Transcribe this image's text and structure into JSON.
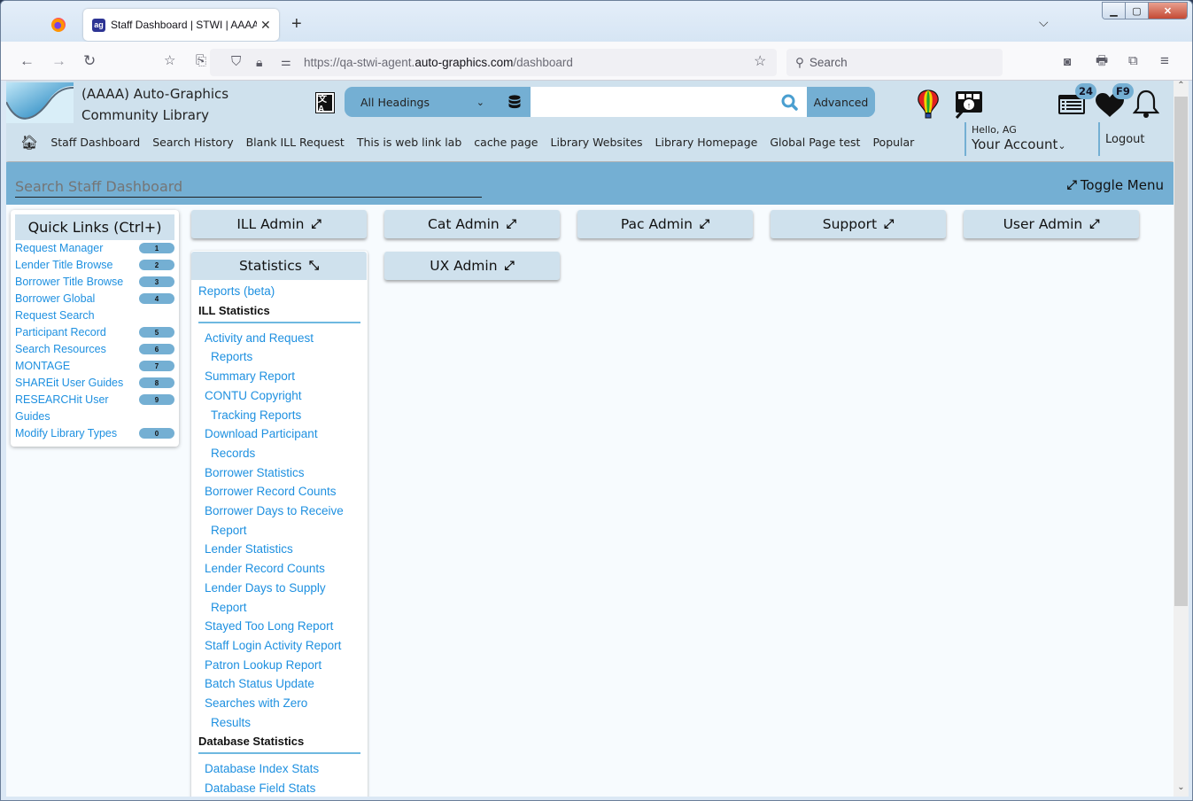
{
  "browser": {
    "tab_title": "Staff Dashboard | STWI | AAAA",
    "tab_favicon": "ag",
    "url_prefix": "https://qa-stwi-agent.",
    "url_domain": "auto-graphics.com",
    "url_path": "/dashboard",
    "search_placeholder": "Search"
  },
  "header": {
    "library_name_line1": "(AAAA) Auto-Graphics",
    "library_name_line2": "Community Library",
    "search_scope": "All Headings",
    "search_value": "",
    "advanced_label": "Advanced",
    "badges": {
      "list": "24",
      "favorites": "F9"
    },
    "nav": [
      "Staff Dashboard",
      "Search History",
      "Blank ILL Request",
      "This is web link lab",
      "cache page",
      "Library Websites",
      "Library Homepage",
      "Global Page test",
      "Popular"
    ],
    "hello": "Hello, AG",
    "account": "Your Account",
    "logout": "Logout"
  },
  "dashboard": {
    "search_placeholder": "Search Staff Dashboard",
    "toggle_menu": "Toggle Menu"
  },
  "quick_links": {
    "title": "Quick Links (Ctrl+)",
    "items": [
      {
        "label": "Request Manager",
        "key": "1"
      },
      {
        "label": "Lender Title Browse",
        "key": "2"
      },
      {
        "label": "Borrower Title Browse",
        "key": "3"
      },
      {
        "label": "Borrower Global Request Search",
        "key": "4"
      },
      {
        "label": "Participant Record",
        "key": "5"
      },
      {
        "label": "Search Resources",
        "key": "6"
      },
      {
        "label": "MONTAGE",
        "key": "7"
      },
      {
        "label": "SHAREit User Guides",
        "key": "8"
      },
      {
        "label": "RESEARCHit User Guides",
        "key": "9"
      },
      {
        "label": "Modify Library Types",
        "key": "0"
      }
    ]
  },
  "admin_cards": [
    {
      "label": "ILL Admin",
      "state": "collapsed"
    },
    {
      "label": "Cat Admin",
      "state": "collapsed"
    },
    {
      "label": "Pac Admin",
      "state": "collapsed"
    },
    {
      "label": "Support",
      "state": "collapsed"
    },
    {
      "label": "User Admin",
      "state": "collapsed"
    },
    {
      "label": "Statistics",
      "state": "expanded"
    },
    {
      "label": "UX Admin",
      "state": "collapsed"
    }
  ],
  "statistics": {
    "top_link": "Reports (beta)",
    "ill_heading": "ILL Statistics",
    "ill_links": [
      [
        "Activity and Request",
        "Reports"
      ],
      [
        "Summary Report"
      ],
      [
        "CONTU Copyright",
        "Tracking Reports"
      ],
      [
        "Download Participant",
        "Records"
      ],
      [
        "Borrower Statistics"
      ],
      [
        "Borrower Record Counts"
      ],
      [
        "Borrower Days to Receive",
        "Report"
      ],
      [
        "Lender Statistics"
      ],
      [
        "Lender Record Counts"
      ],
      [
        "Lender Days to Supply",
        "Report"
      ],
      [
        "Stayed Too Long Report"
      ],
      [
        "Staff Login Activity Report"
      ],
      [
        "Patron Lookup Report"
      ],
      [
        "Batch Status Update"
      ],
      [
        "Searches with Zero",
        "Results"
      ]
    ],
    "db_heading": "Database Statistics",
    "db_links": [
      "Database Index Stats",
      "Database Field Stats"
    ]
  }
}
